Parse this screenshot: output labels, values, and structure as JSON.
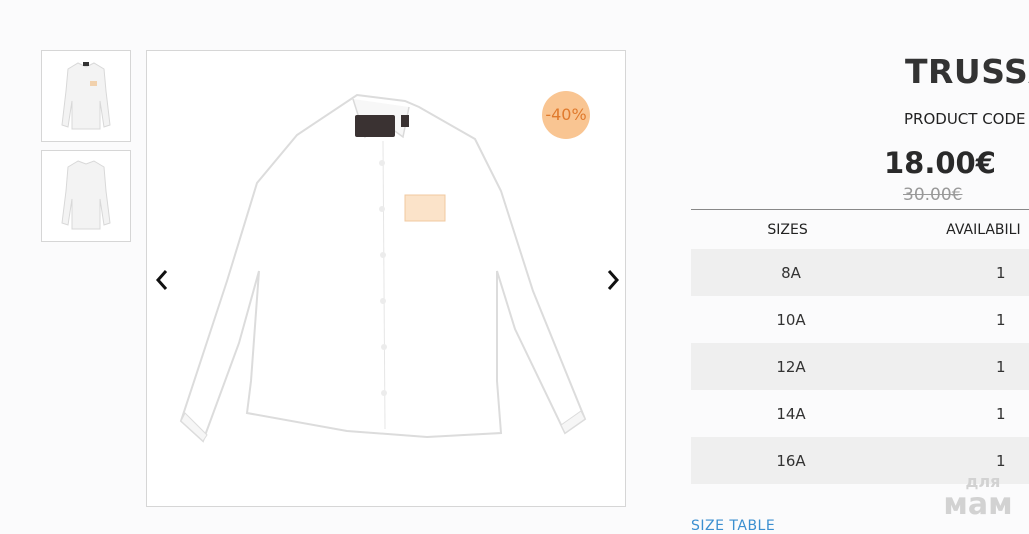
{
  "gallery": {
    "thumbnails": [
      {
        "name": "shirt-front-view"
      },
      {
        "name": "shirt-back-view"
      }
    ],
    "discount_badge": "-40%",
    "prev_icon": "chevron-left-icon",
    "next_icon": "chevron-right-icon"
  },
  "product": {
    "title": "TRUSSA",
    "code_label": "PRODUCT CODE",
    "price": "18.00€",
    "old_price": "30.00€"
  },
  "sizes_table": {
    "headers": [
      "SIZES",
      "AVAILABILI"
    ],
    "rows": [
      {
        "size": "8A",
        "availability": "1"
      },
      {
        "size": "10A",
        "availability": "1"
      },
      {
        "size": "12A",
        "availability": "1"
      },
      {
        "size": "14A",
        "availability": "1"
      },
      {
        "size": "16A",
        "availability": "1"
      }
    ]
  },
  "size_table_link": "SIZE TABLE",
  "watermark": {
    "top": "для",
    "bottom": "мам"
  },
  "colors": {
    "badge_bg": "#f9c592",
    "badge_text": "#e07a2d",
    "link": "#3b8fd0",
    "row_shade": "#efefef"
  }
}
